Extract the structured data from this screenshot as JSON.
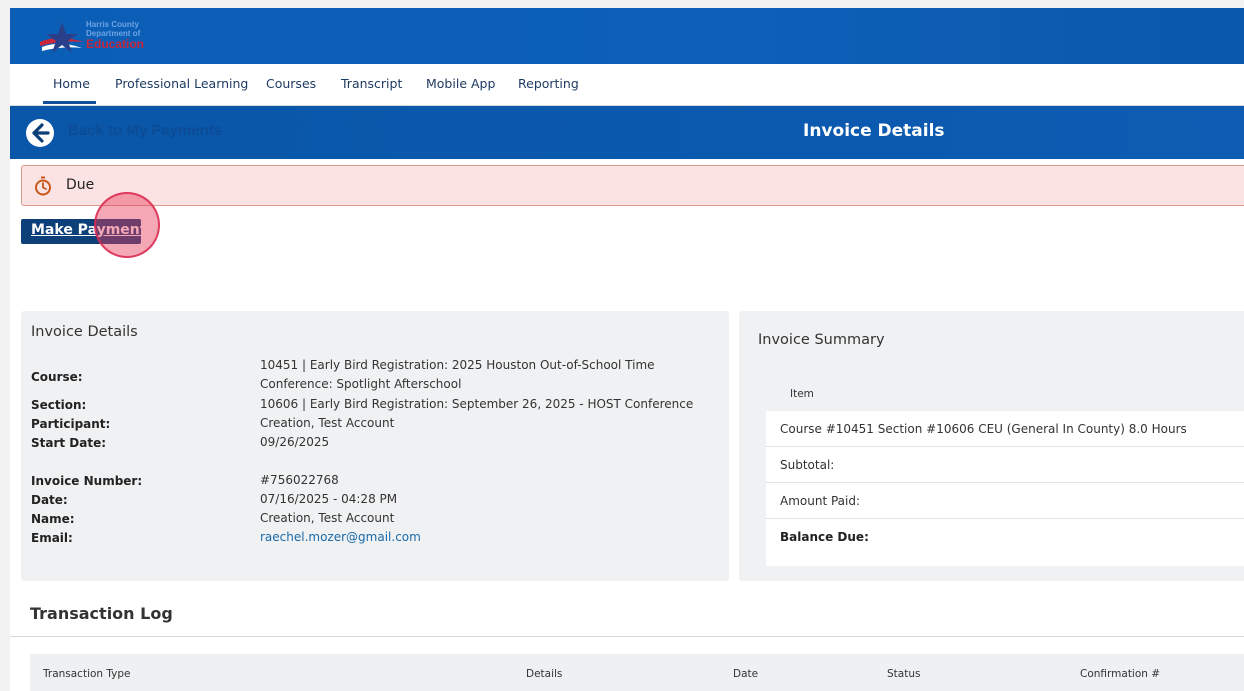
{
  "header": {
    "logo": {
      "line1": "Harris County",
      "line2": "Department of",
      "line3": "Education"
    }
  },
  "nav": {
    "items": [
      {
        "label": "Home",
        "active": true
      },
      {
        "label": "Professional Learning"
      },
      {
        "label": "Courses"
      },
      {
        "label": "Transcript"
      },
      {
        "label": "Mobile App"
      },
      {
        "label": "Reporting"
      }
    ]
  },
  "titlebar": {
    "back_label": "Back to My Payments",
    "title": "Invoice Details"
  },
  "alert": {
    "status": "Due",
    "icon": "stopwatch-icon"
  },
  "actions": {
    "make_payment": "Make Payment"
  },
  "invoice_details": {
    "title": "Invoice Details",
    "labels": {
      "course": "Course:",
      "section": "Section:",
      "participant": "Participant:",
      "start_date": "Start Date:",
      "invoice_number": "Invoice Number:",
      "date": "Date:",
      "name": "Name:",
      "email": "Email:"
    },
    "values": {
      "course": "10451 | Early Bird Registration: 2025 Houston Out-of-School Time Conference: Spotlight Afterschool",
      "section": "10606 | Early Bird Registration: September 26, 2025 - HOST Conference",
      "participant": "Creation, Test Account",
      "start_date": "09/26/2025",
      "invoice_number": "#756022768",
      "date": "07/16/2025 - 04:28 PM",
      "name": "Creation, Test Account",
      "email": "raechel.mozer@gmail.com"
    }
  },
  "invoice_summary": {
    "title": "Invoice Summary",
    "column_item": "Item",
    "rows": {
      "item": "Course #10451 Section #10606 CEU (General In County) 8.0 Hours",
      "subtotal": "Subtotal:",
      "amount_paid": "Amount Paid:",
      "balance_due": "Balance Due:"
    }
  },
  "transaction_log": {
    "title": "Transaction Log",
    "columns": {
      "type": "Transaction Type",
      "details": "Details",
      "date": "Date",
      "status": "Status",
      "confirmation": "Confirmation #"
    }
  },
  "colors": {
    "brand_blue": "#0b5eb5",
    "alert_bg": "#fbe3e3",
    "button_navy": "#0d3f78",
    "link": "#1a6aa8"
  }
}
